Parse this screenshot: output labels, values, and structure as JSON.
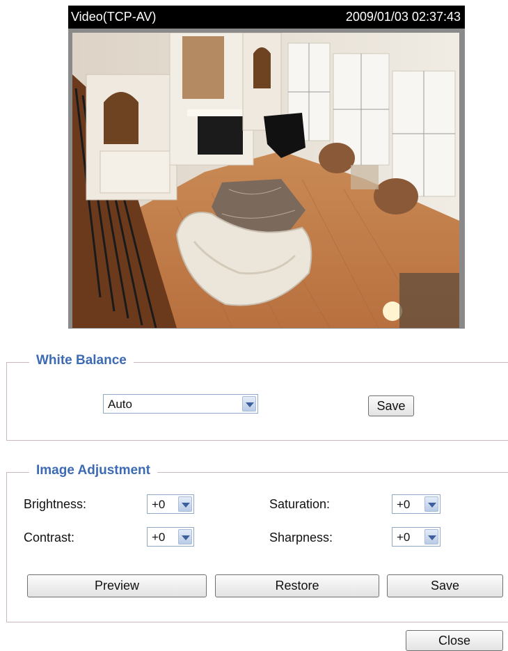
{
  "video": {
    "title": "Video(TCP-AV)",
    "timestamp": "2009/01/03 02:37:43"
  },
  "white_balance": {
    "legend": "White Balance",
    "mode": "Auto",
    "save_label": "Save"
  },
  "image_adjustment": {
    "legend": "Image Adjustment",
    "brightness_label": "Brightness:",
    "brightness_value": "+0",
    "contrast_label": "Contrast:",
    "contrast_value": "+0",
    "saturation_label": "Saturation:",
    "saturation_value": "+0",
    "sharpness_label": "Sharpness:",
    "sharpness_value": "+0",
    "preview_label": "Preview",
    "restore_label": "Restore",
    "save_label": "Save"
  },
  "footer": {
    "close_label": "Close"
  },
  "colors": {
    "legend_text": "#3d6bb3",
    "fieldset_border": "#cbb8bd",
    "select_arrow": "#3d5f9b"
  }
}
